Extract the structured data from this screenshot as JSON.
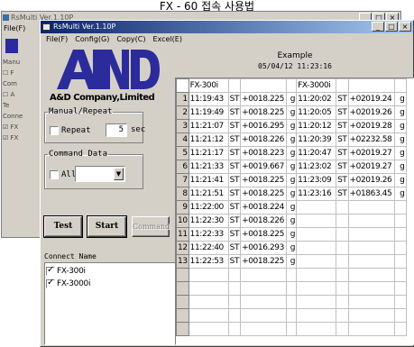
{
  "caption": "FX - 60 접속 사용법",
  "bg_window": {
    "title": "RsMulti Ver.1.10P",
    "menu": "File(F)",
    "side_items": [
      "Manu",
      "☐ F",
      "Com",
      "☐ A",
      "Te",
      "Conne",
      "☑ FX",
      "☑ FX"
    ]
  },
  "window": {
    "title": "RsMulti Ver.1.10P",
    "menu": [
      "File(F)",
      "Config(G)",
      "Copy(C)",
      "Excel(E)"
    ],
    "minimize": "_",
    "maximize": "□",
    "close": "×"
  },
  "left": {
    "logo": "A&D",
    "company": "A&D Company,Limited",
    "manual_repeat": {
      "legend": "Manual/Repeat",
      "repeat_label": "Repeat",
      "repeat_checked": false,
      "interval": "5",
      "unit": "sec"
    },
    "command_data": {
      "legend": "Command Data",
      "all_label": "All",
      "all_checked": false,
      "selected": ""
    },
    "buttons": {
      "test": "Test",
      "start": "Start",
      "command": "Command"
    },
    "connect_label": "Connect Name",
    "connect_items": [
      {
        "name": "FX-300i",
        "checked": true
      },
      {
        "name": "FX-3000i",
        "checked": true
      }
    ]
  },
  "right": {
    "title": "Example",
    "datetime": "05/04/12 11:23:16",
    "headers": [
      "FX-300i",
      "",
      "",
      "",
      "FX-3000i",
      "",
      "",
      ""
    ],
    "rows": [
      {
        "n": "1",
        "c": [
          "11:19:43",
          "ST",
          "+0018.225",
          "g",
          "11:20:02",
          "ST",
          "+02019.24",
          "g"
        ]
      },
      {
        "n": "2",
        "c": [
          "11:19:49",
          "ST",
          "+0018.225",
          "g",
          "11:20:05",
          "ST",
          "+02019.26",
          "g"
        ]
      },
      {
        "n": "3",
        "c": [
          "11:21:07",
          "ST",
          "+0016.295",
          "g",
          "11:20:12",
          "ST",
          "+02019.28",
          "g"
        ]
      },
      {
        "n": "4",
        "c": [
          "11:21:12",
          "ST",
          "+0018.226",
          "g",
          "11:20:39",
          "ST",
          "+02232.58",
          "g"
        ]
      },
      {
        "n": "5",
        "c": [
          "11:21:17",
          "ST",
          "+0018.223",
          "g",
          "11:20:47",
          "ST",
          "+02019.27",
          "g"
        ]
      },
      {
        "n": "6",
        "c": [
          "11:21:33",
          "ST",
          "+0019.667",
          "g",
          "11:23:02",
          "ST",
          "+02019.27",
          "g"
        ]
      },
      {
        "n": "7",
        "c": [
          "11:21:41",
          "ST",
          "+0018.225",
          "g",
          "11:23:09",
          "ST",
          "+02019.26",
          "g"
        ]
      },
      {
        "n": "8",
        "c": [
          "11:21:51",
          "ST",
          "+0018.225",
          "g",
          "11:23:16",
          "ST",
          "+01863.45",
          "g"
        ]
      },
      {
        "n": "9",
        "c": [
          "11:22:00",
          "ST",
          "+0018.224",
          "g",
          "",
          "",
          "",
          ""
        ]
      },
      {
        "n": "10",
        "c": [
          "11:22:30",
          "ST",
          "+0018.226",
          "g",
          "",
          "",
          "",
          ""
        ]
      },
      {
        "n": "11",
        "c": [
          "11:22:33",
          "ST",
          "+0018.225",
          "g",
          "",
          "",
          "",
          ""
        ]
      },
      {
        "n": "12",
        "c": [
          "11:22:40",
          "ST",
          "+0016.293",
          "g",
          "",
          "",
          "",
          ""
        ]
      },
      {
        "n": "13",
        "c": [
          "11:22:53",
          "ST",
          "+0018.225",
          "g",
          "",
          "",
          "",
          ""
        ]
      },
      {
        "n": "",
        "c": [
          "",
          "",
          "",
          "",
          "",
          "",
          "",
          ""
        ]
      },
      {
        "n": "",
        "c": [
          "",
          "",
          "",
          "",
          "",
          "",
          "",
          ""
        ]
      },
      {
        "n": "",
        "c": [
          "",
          "",
          "",
          "",
          "",
          "",
          "",
          ""
        ]
      },
      {
        "n": "",
        "c": [
          "",
          "",
          "",
          "",
          "",
          "",
          "",
          ""
        ]
      },
      {
        "n": "",
        "c": [
          "",
          "",
          "",
          "",
          "",
          "",
          "",
          ""
        ]
      }
    ]
  },
  "colors": {
    "titlebar_start": "#0a246a",
    "titlebar_end": "#a6caf0",
    "logo": "#2b2b9c",
    "face": "#d4d0c8"
  }
}
